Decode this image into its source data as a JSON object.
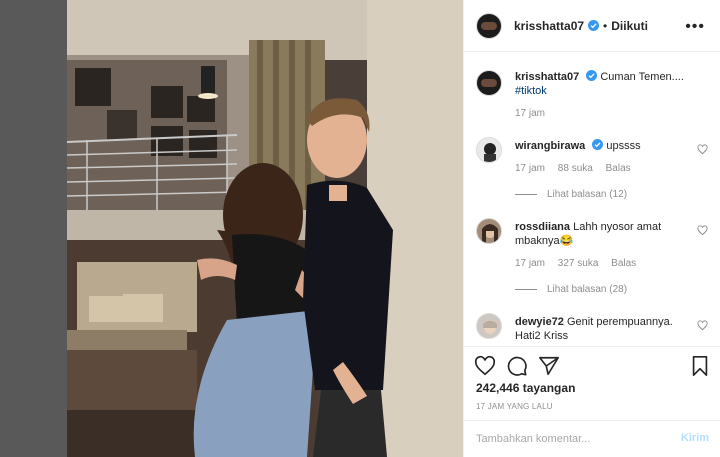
{
  "post": {
    "username": "krisshatta07",
    "separator": "•",
    "follow_status": "Diikuti",
    "more_label": "•••"
  },
  "caption": {
    "username": "krisshatta07",
    "text": "Cuman Temen....",
    "hashtag": "#tiktok",
    "time": "17 jam"
  },
  "comments": [
    {
      "username": "wirangbirawa",
      "text": "upssss",
      "time": "17 jam",
      "likes": "88 suka",
      "reply": "Balas",
      "view_replies": "Lihat balasan (12)"
    },
    {
      "username": "rossdiiana",
      "text": "Lahh nyosor amat mbaknya😂",
      "time": "17 jam",
      "likes": "327 suka",
      "reply": "Balas",
      "view_replies": "Lihat balasan (28)"
    },
    {
      "username": "dewyie72",
      "text": "Genit perempuannya. Hati2 Kriss"
    }
  ],
  "actions": {
    "views": "242,446 tayangan",
    "timestamp": "17 JAM YANG LALU"
  },
  "add_comment": {
    "placeholder": "Tambahkan komentar...",
    "post_label": "Kirim"
  },
  "colors": {
    "link": "#00376b",
    "verified": "#3897f0",
    "muted": "#8e8e8e",
    "post_disabled": "#b2dffc"
  }
}
